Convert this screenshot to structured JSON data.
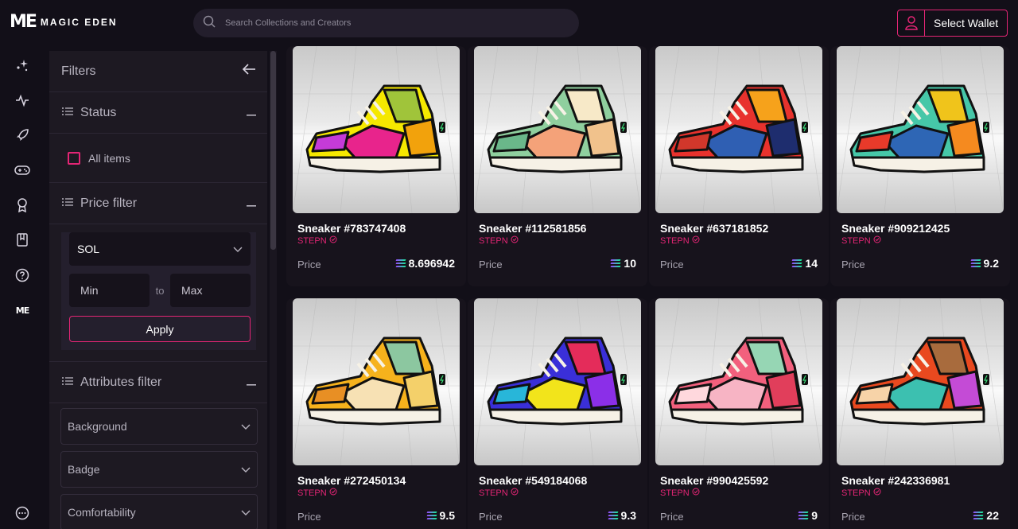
{
  "header": {
    "logo_mark": "ME",
    "logo_text": "MAGIC EDEN",
    "search_placeholder": "Search Collections and Creators",
    "wallet_label": "Select Wallet"
  },
  "rail": {
    "items": [
      "sparkles-icon",
      "activity-icon",
      "rocket-icon",
      "gamepad-icon",
      "award-icon",
      "book-icon",
      "help-icon",
      "me-logo-icon"
    ],
    "bottom": "more-icon"
  },
  "filters": {
    "title": "Filters",
    "status": {
      "title": "Status",
      "all_items": "All items"
    },
    "price": {
      "title": "Price filter",
      "currency": "SOL",
      "min_placeholder": "Min",
      "to": "to",
      "max_placeholder": "Max",
      "apply": "Apply"
    },
    "attributes": {
      "title": "Attributes filter",
      "items": [
        "Background",
        "Badge",
        "Comfortability"
      ]
    }
  },
  "cards": [
    {
      "name": "Sneaker #783747408",
      "collection": "STEPN",
      "price_label": "Price",
      "price": "8.696942",
      "palette": [
        "#f5e800",
        "#e8248c",
        "#a0c43a",
        "#c53bd8",
        "#f2a20c"
      ]
    },
    {
      "name": "Sneaker #112581856",
      "collection": "STEPN",
      "price_label": "Price",
      "price": "10",
      "palette": [
        "#8fcf9e",
        "#f4a279",
        "#f7e9c8",
        "#6ab78a",
        "#f1c28c"
      ]
    },
    {
      "name": "Sneaker #637181852",
      "collection": "STEPN",
      "price_label": "Price",
      "price": "14",
      "palette": [
        "#e8322d",
        "#2f5fb3",
        "#f6a21b",
        "#d1372b",
        "#1e2d6e"
      ]
    },
    {
      "name": "Sneaker #909212425",
      "collection": "STEPN",
      "price_label": "Price",
      "price": "9.2",
      "palette": [
        "#46c7a8",
        "#2e66b5",
        "#f0c41b",
        "#e83a2a",
        "#f58a1f"
      ]
    },
    {
      "name": "Sneaker #272450134",
      "collection": "STEPN",
      "price_label": "Price",
      "price": "9.5",
      "palette": [
        "#f6b21c",
        "#f7e1b4",
        "#8cc7a0",
        "#e88f24",
        "#f4d06a"
      ]
    },
    {
      "name": "Sneaker #549184068",
      "collection": "STEPN",
      "price_label": "Price",
      "price": "9.3",
      "palette": [
        "#3a2fd8",
        "#f2e41b",
        "#e42c5a",
        "#28b6d9",
        "#8b2fe8"
      ]
    },
    {
      "name": "Sneaker #990425592",
      "collection": "STEPN",
      "price_label": "Price",
      "price": "9",
      "palette": [
        "#f2607d",
        "#f7b4c4",
        "#96d6b4",
        "#ffd8dd",
        "#e13e5b"
      ]
    },
    {
      "name": "Sneaker #242336981",
      "collection": "STEPN",
      "price_label": "Price",
      "price": "22",
      "palette": [
        "#e9491f",
        "#3cc0b0",
        "#a86b3d",
        "#f7d3a8",
        "#c44bd6"
      ]
    }
  ]
}
